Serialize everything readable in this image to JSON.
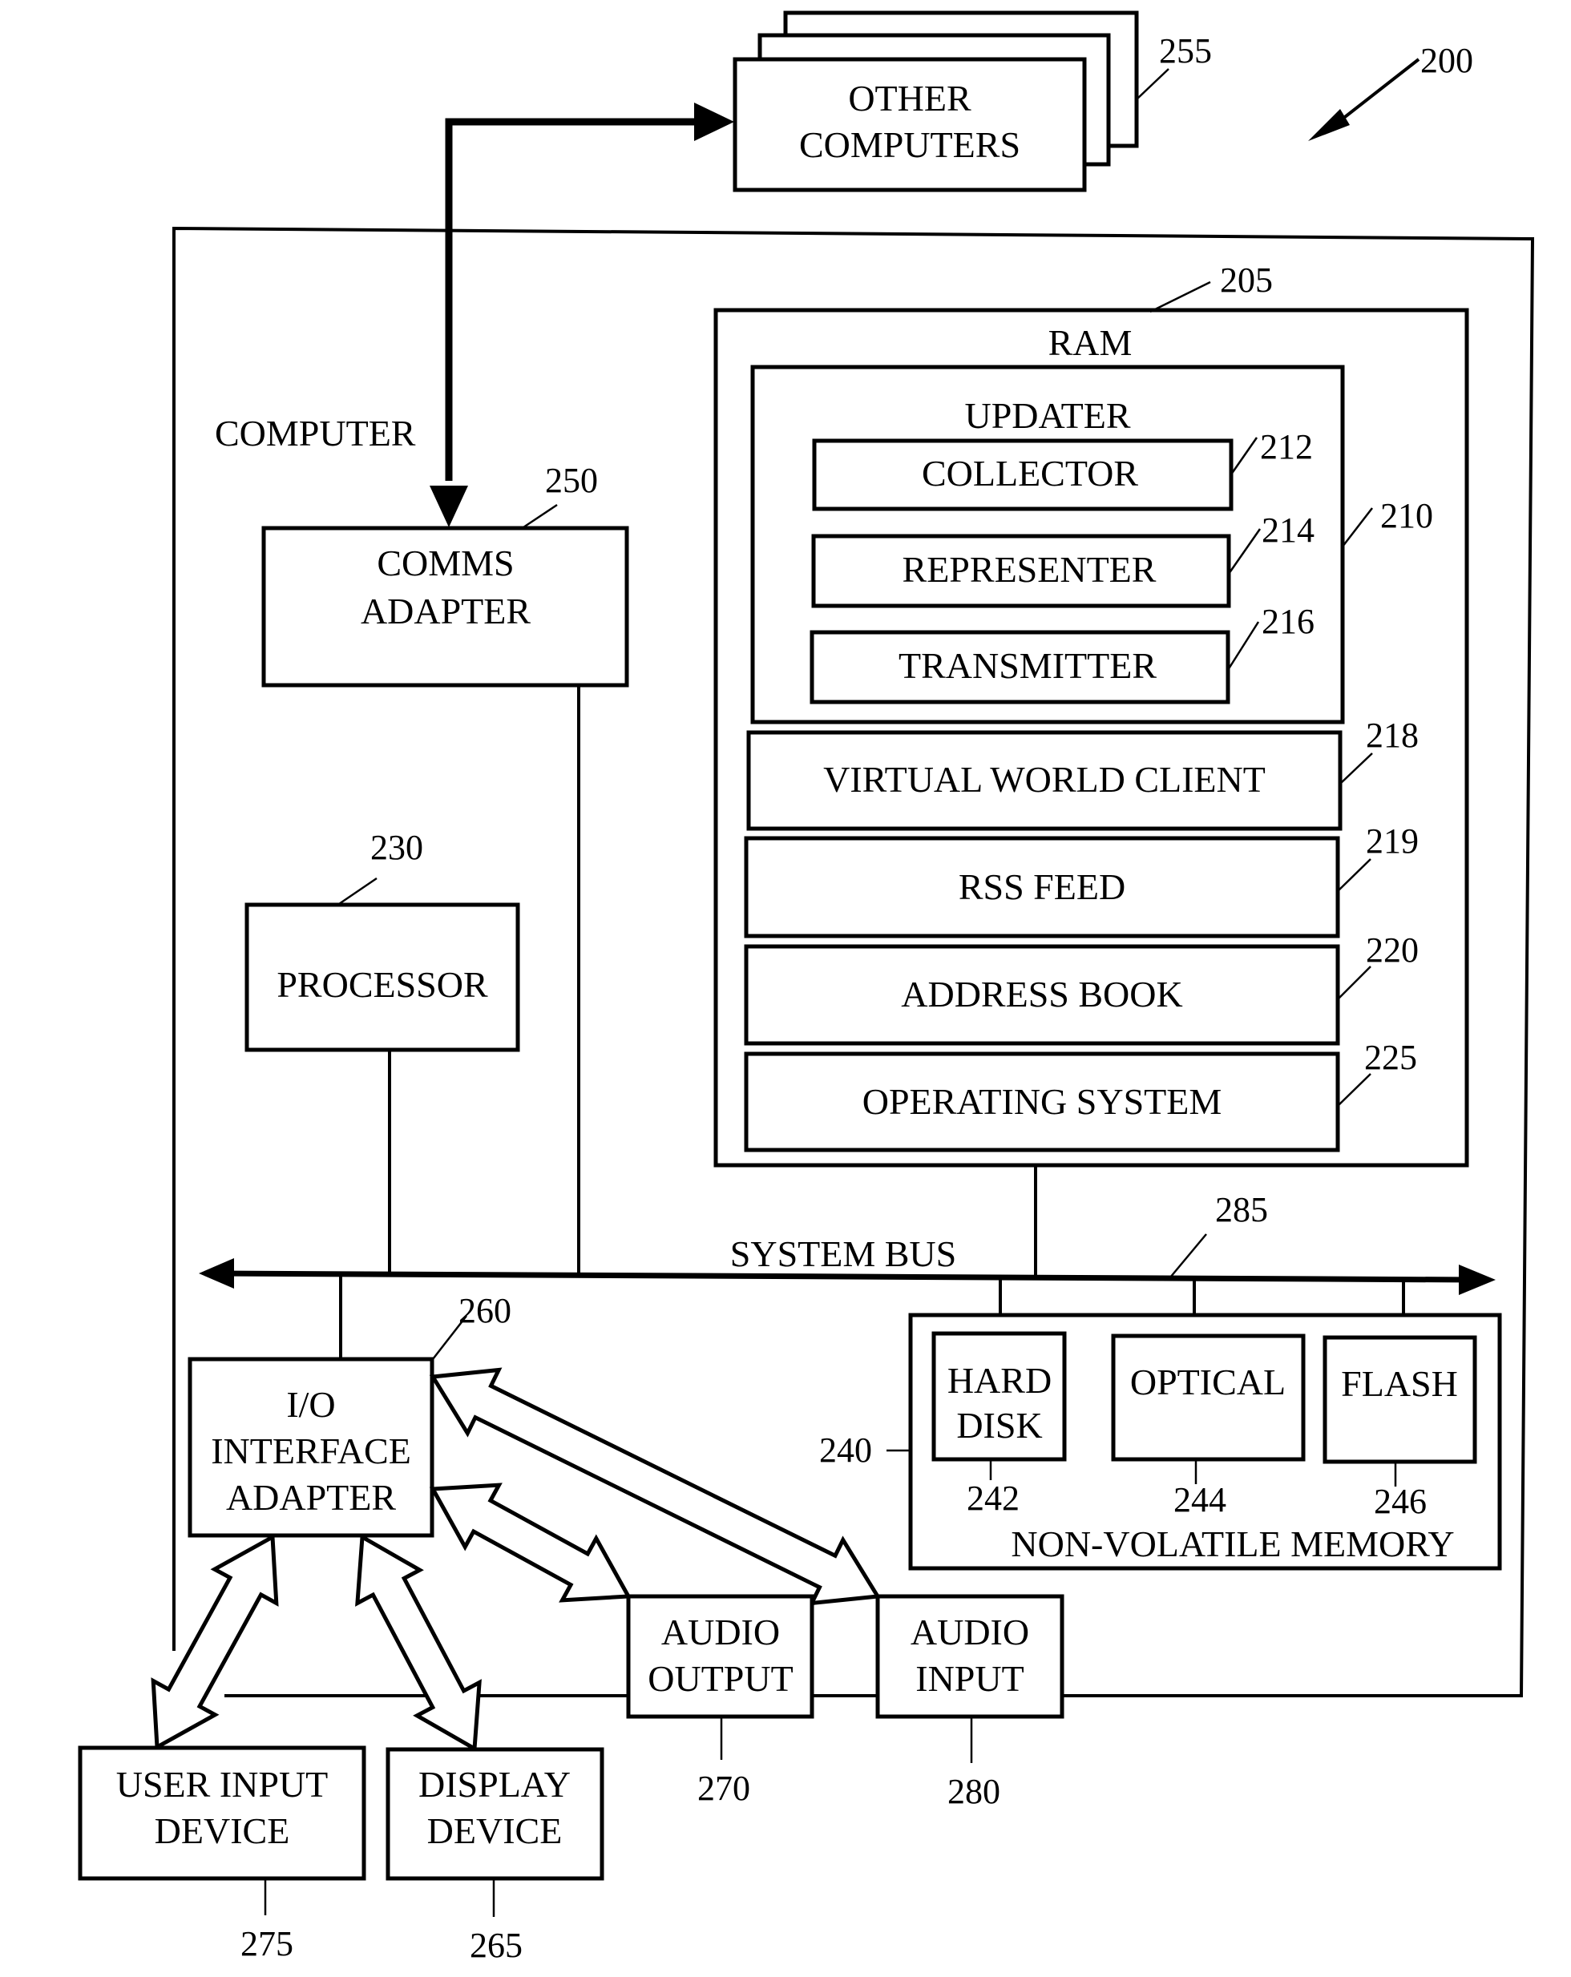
{
  "figure": {
    "ref": "200",
    "computer_label": "COMPUTER"
  },
  "other_computers": {
    "lines": [
      "OTHER",
      "COMPUTERS"
    ],
    "ref": "255"
  },
  "ram": {
    "label": "RAM",
    "ref": "205"
  },
  "updater": {
    "label": "UPDATER",
    "ref": "210"
  },
  "collector": {
    "label": "COLLECTOR",
    "ref": "212"
  },
  "representer": {
    "label": "REPRESENTER",
    "ref": "214"
  },
  "transmitter": {
    "label": "TRANSMITTER",
    "ref": "216"
  },
  "virtual_world_client": {
    "label": "VIRTUAL WORLD CLIENT",
    "ref": "218"
  },
  "rss_feed": {
    "label": "RSS FEED",
    "ref": "219"
  },
  "address_book": {
    "label": "ADDRESS BOOK",
    "ref": "220"
  },
  "operating_system": {
    "label": "OPERATING SYSTEM",
    "ref": "225"
  },
  "comms_adapter": {
    "lines": [
      "COMMS",
      "ADAPTER"
    ],
    "ref": "250"
  },
  "processor": {
    "label": "PROCESSOR",
    "ref": "230"
  },
  "system_bus": {
    "label": "SYSTEM BUS",
    "ref": "285"
  },
  "non_volatile_memory": {
    "label": "NON-VOLATILE MEMORY",
    "ref": "240"
  },
  "hard_disk": {
    "lines": [
      "HARD",
      "DISK"
    ],
    "ref": "242"
  },
  "optical": {
    "label": "OPTICAL",
    "ref": "244"
  },
  "flash": {
    "label": "FLASH",
    "ref": "246"
  },
  "io_adapter": {
    "lines": [
      "I/O",
      "INTERFACE",
      "ADAPTER"
    ],
    "ref": "260"
  },
  "audio_output": {
    "lines": [
      "AUDIO",
      "OUTPUT"
    ],
    "ref": "270"
  },
  "audio_input": {
    "lines": [
      "AUDIO",
      "INPUT"
    ],
    "ref": "280"
  },
  "user_input_device": {
    "lines": [
      "USER INPUT",
      "DEVICE"
    ],
    "ref": "275"
  },
  "display_device": {
    "lines": [
      "DISPLAY",
      "DEVICE"
    ],
    "ref": "265"
  }
}
